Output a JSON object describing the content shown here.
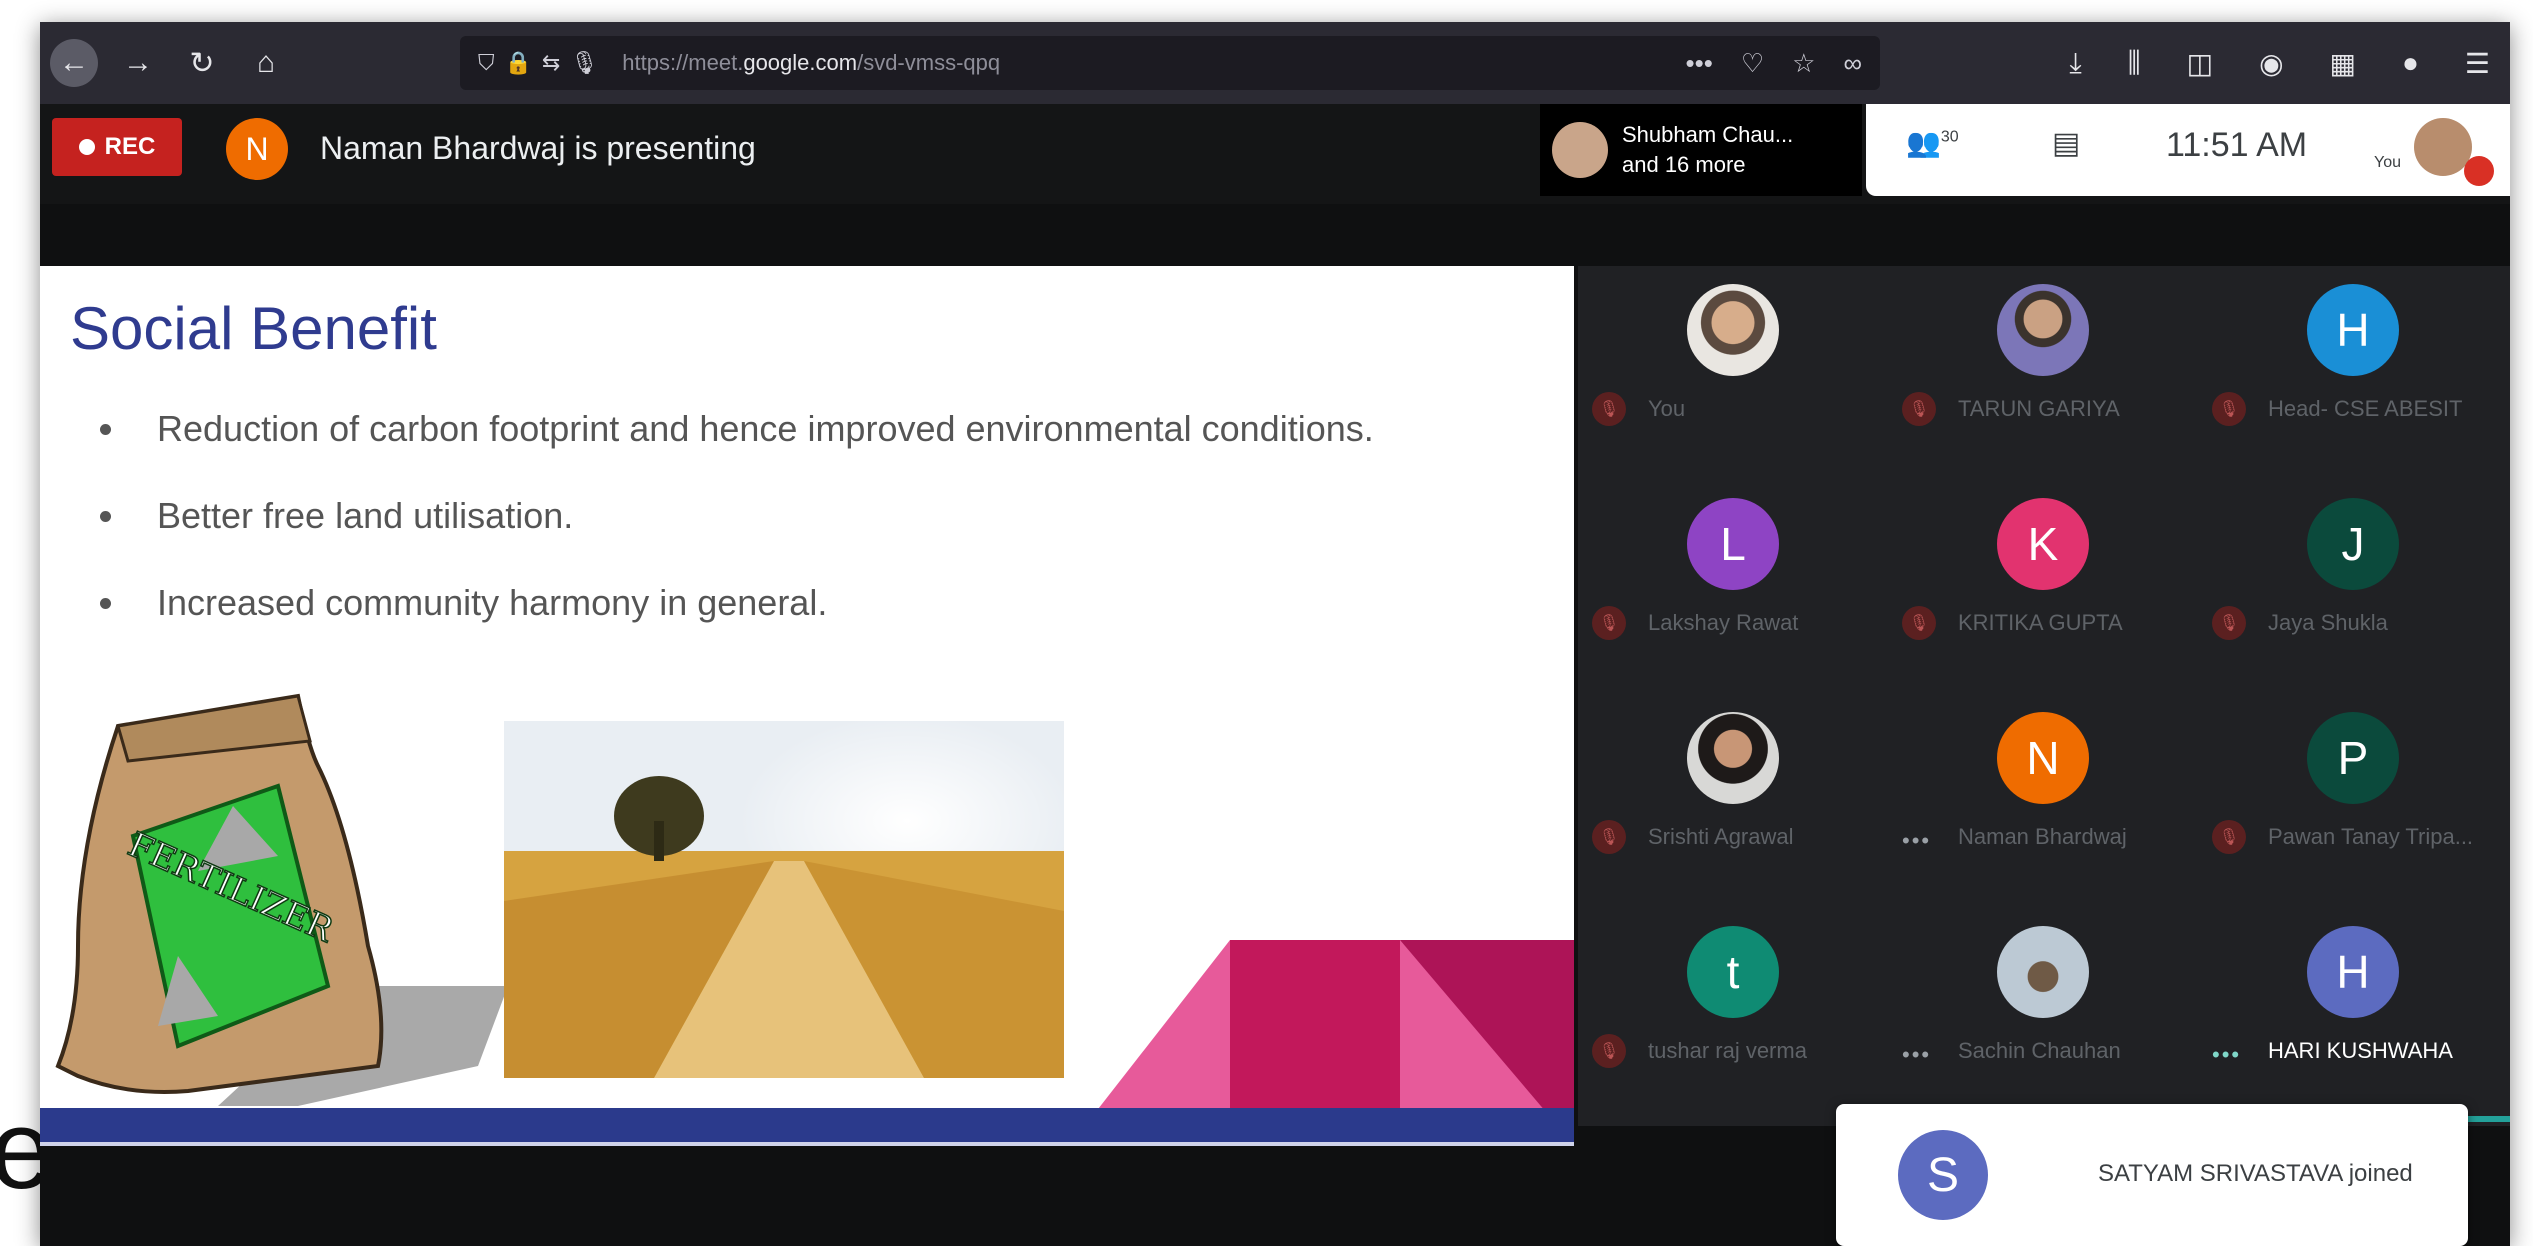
{
  "browser": {
    "url_prefix": "https://meet.",
    "url_domain": "google.com",
    "url_path": "/svd-vmss-qpq"
  },
  "meet": {
    "rec_label": "REC",
    "presenter_initial": "N",
    "presenting_text": "Naman Bhardwaj is presenting",
    "others_line1": "Shubham Chau...",
    "others_line2": "and 16 more",
    "participant_count": "30",
    "time": "11:51 AM",
    "you_label": "You"
  },
  "slide": {
    "title": "Social Benefit",
    "bullets": [
      "Reduction of carbon footprint and hence improved environmental conditions.",
      "Better free land utilisation.",
      "Increased community harmony in general."
    ],
    "bag_text": "FERTILIZER"
  },
  "participants": [
    {
      "name": "You",
      "initial": "",
      "color": ""
    },
    {
      "name": "TARUN GARIYA",
      "initial": "",
      "color": ""
    },
    {
      "name": "Head- CSE ABESIT",
      "initial": "H",
      "color": "#1a8fd6"
    },
    {
      "name": "Lakshay Rawat",
      "initial": "L",
      "color": "#8e44c4"
    },
    {
      "name": "KRITIKA GUPTA",
      "initial": "K",
      "color": "#e2336f"
    },
    {
      "name": "Jaya Shukla",
      "initial": "J",
      "color": "#0b4a3c"
    },
    {
      "name": "Srishti Agrawal",
      "initial": "",
      "color": ""
    },
    {
      "name": "Naman Bhardwaj",
      "initial": "N",
      "color": "#ef6c00"
    },
    {
      "name": "Pawan Tanay Tripa...",
      "initial": "P",
      "color": "#0b4a3c"
    },
    {
      "name": "tushar raj verma",
      "initial": "t",
      "color": "#0f8b73"
    },
    {
      "name": "Sachin Chauhan",
      "initial": "",
      "color": ""
    },
    {
      "name": "HARI KUSHWAHA",
      "initial": "H",
      "color": "#5c6bc0"
    }
  ],
  "toast": {
    "initial": "S",
    "text": "SATYAM SRIVASTAVA joined"
  },
  "page_fragment": "e"
}
